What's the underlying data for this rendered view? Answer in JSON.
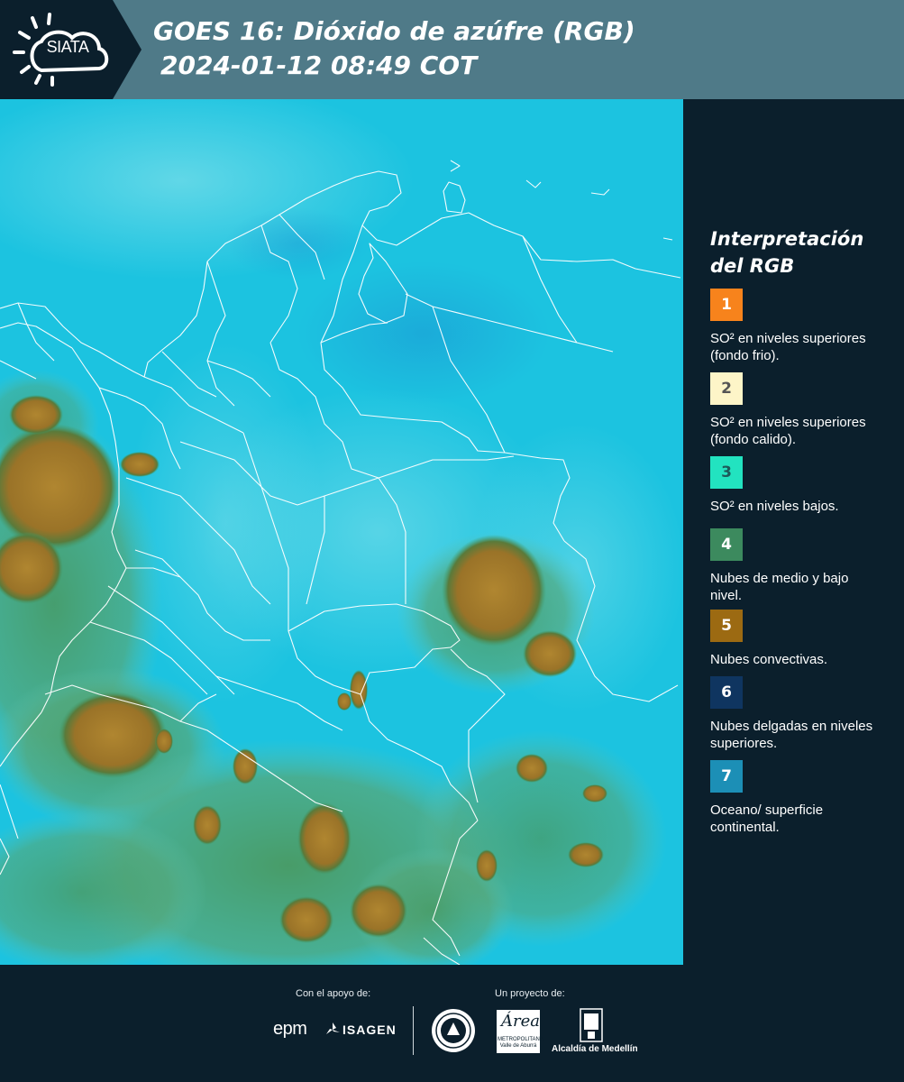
{
  "header": {
    "logo_text": "SIATA",
    "title_line1": "GOES 16: Dióxido de azúfre (RGB)",
    "title_line2": "2024-01-12 08:49 COT"
  },
  "legend": {
    "title_line1": "Interpretación",
    "title_line2": "del RGB",
    "items": [
      {
        "number": "1",
        "label": "SO² en niveles superiores (fondo frio).",
        "color": "#f7831c",
        "text_color": "#ffffff"
      },
      {
        "number": "2",
        "label": "SO² en niveles superiores (fondo calido).",
        "color": "#fdf5c8",
        "text_color": "#555555"
      },
      {
        "number": "3",
        "label": "SO² en niveles bajos.",
        "color": "#22e3c0",
        "text_color": "#1d5a5a"
      },
      {
        "number": "4",
        "label": "Nubes de medio y bajo nivel.",
        "color": "#3c8a5e",
        "text_color": "#ffffff"
      },
      {
        "number": "5",
        "label": "Nubes convectivas.",
        "color": "#9c6a12",
        "text_color": "#ffffff"
      },
      {
        "number": "6",
        "label": "Nubes delgadas en niveles superiores.",
        "color": "#0f3560",
        "text_color": "#ffffff"
      },
      {
        "number": "7",
        "label": "Oceano/ superficie continental.",
        "color": "#1c8fb6",
        "text_color": "#ffffff"
      }
    ]
  },
  "footer": {
    "support_label": "Con el apoyo de:",
    "project_label": "Un proyecto de:",
    "sponsors": [
      "epm",
      "ISAGEN"
    ],
    "partners": [
      "Área Metropolitana Valle de Aburrá",
      "Alcaldía de Medellín"
    ],
    "alcaldia_text": "Alcaldía de Medellín"
  },
  "map": {
    "ocean_color": "#1ec6e0",
    "cloud_colors": {
      "convective": "#a07a24",
      "mid_low": "#4e9d6a"
    },
    "border_color": "#ffffff"
  }
}
